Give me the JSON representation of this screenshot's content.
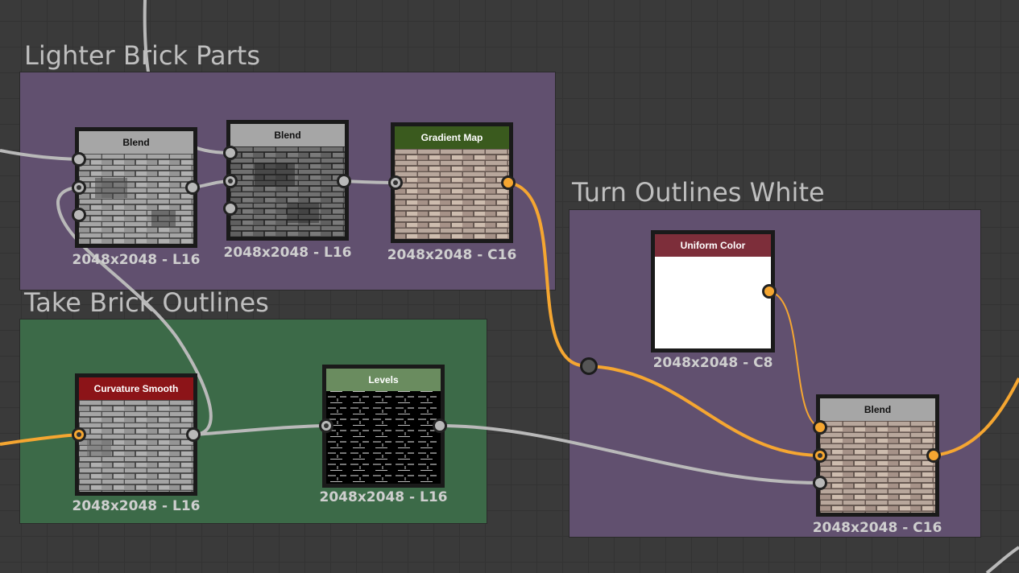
{
  "frames": {
    "lighter": {
      "title": "Lighter Brick Parts"
    },
    "outlines": {
      "title": "Take Brick Outlines"
    },
    "white": {
      "title": "Turn Outlines White"
    }
  },
  "nodes": {
    "blend1": {
      "title": "Blend",
      "resolution": "2048x2048 - L16",
      "header_color": "#a6a6a6"
    },
    "blend2": {
      "title": "Blend",
      "resolution": "2048x2048 - L16",
      "header_color": "#a6a6a6"
    },
    "gradient_map": {
      "title": "Gradient Map",
      "resolution": "2048x2048 - C16",
      "header_color": "#3a5a1e"
    },
    "uniform_color": {
      "title": "Uniform Color",
      "resolution": "2048x2048 - C8",
      "header_color": "#7d2e3a"
    },
    "curvature_smooth": {
      "title": "Curvature Smooth",
      "resolution": "2048x2048 - L16",
      "header_color": "#8c1418"
    },
    "levels": {
      "title": "Levels",
      "resolution": "2048x2048 - L16",
      "header_color": "#6a8c5f"
    },
    "blend3": {
      "title": "Blend",
      "resolution": "2048x2048 - C16",
      "header_color": "#a6a6a6"
    }
  },
  "colors": {
    "wire_grey": "#b9b9b9",
    "wire_orange": "#f5a631",
    "frame_purple": "#61506f",
    "frame_green": "#3c6a48"
  }
}
